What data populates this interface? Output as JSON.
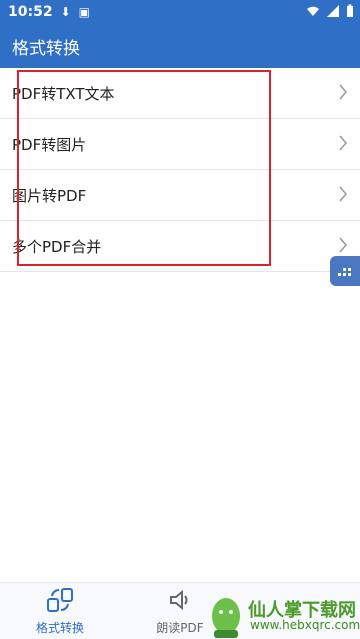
{
  "status": {
    "time": "10:52"
  },
  "appbar": {
    "title": "格式转换"
  },
  "list": [
    {
      "label": "PDF转TXT文本"
    },
    {
      "label": "PDF转图片"
    },
    {
      "label": "图片转PDF"
    },
    {
      "label": "多个PDF合并"
    }
  ],
  "bottom_nav": [
    {
      "label": "格式转换"
    },
    {
      "label": "朗读PDF"
    }
  ],
  "watermark": {
    "line1": "仙人掌下载网",
    "line2": "www.hebxqrc.com"
  },
  "colors": {
    "primary": "#2f6fc5",
    "highlight_border": "#d8232a"
  }
}
